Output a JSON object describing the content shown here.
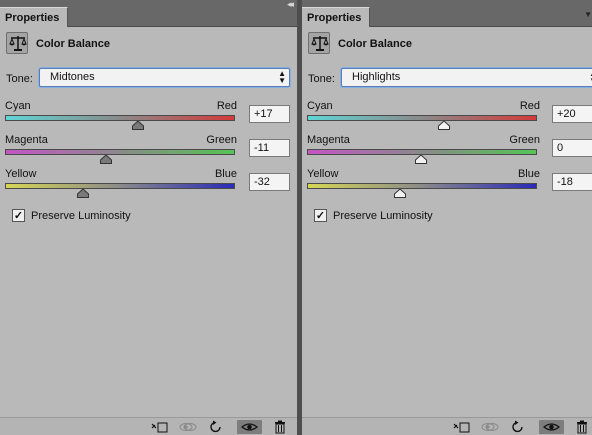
{
  "panels": [
    {
      "tab": "Properties",
      "title": "Color Balance",
      "tone_label": "Tone:",
      "tone_value": "Midtones",
      "sliders": [
        {
          "left": "Cyan",
          "right": "Red",
          "value": "+17",
          "level": 17
        },
        {
          "left": "Magenta",
          "right": "Green",
          "value": "-11",
          "level": -11
        },
        {
          "left": "Yellow",
          "right": "Blue",
          "value": "-32",
          "level": -32
        }
      ],
      "preserve_label": "Preserve Luminosity",
      "preserve_checked": true
    },
    {
      "tab": "Properties",
      "title": "Color Balance",
      "tone_label": "Tone:",
      "tone_value": "Highlights",
      "sliders": [
        {
          "left": "Cyan",
          "right": "Red",
          "value": "+20",
          "level": 20
        },
        {
          "left": "Magenta",
          "right": "Green",
          "value": "0",
          "level": 0
        },
        {
          "left": "Yellow",
          "right": "Blue",
          "value": "-18",
          "level": -18
        }
      ],
      "preserve_label": "Preserve Luminosity",
      "preserve_checked": true
    }
  ],
  "slider_range": [
    -100,
    100
  ],
  "gradients": [
    [
      "#5fd6d6",
      "#8a8a8a",
      "#d43a3a"
    ],
    [
      "#c455c4",
      "#8a8a8a",
      "#55c455"
    ],
    [
      "#d6d655",
      "#8a8a8a",
      "#2a2ab8"
    ]
  ],
  "icons": {
    "header": "balance-scale-icon",
    "footer": [
      "clip-to-layer-icon",
      "view-previous-state-icon",
      "reset-icon",
      "visibility-eye-icon",
      "delete-icon"
    ]
  }
}
